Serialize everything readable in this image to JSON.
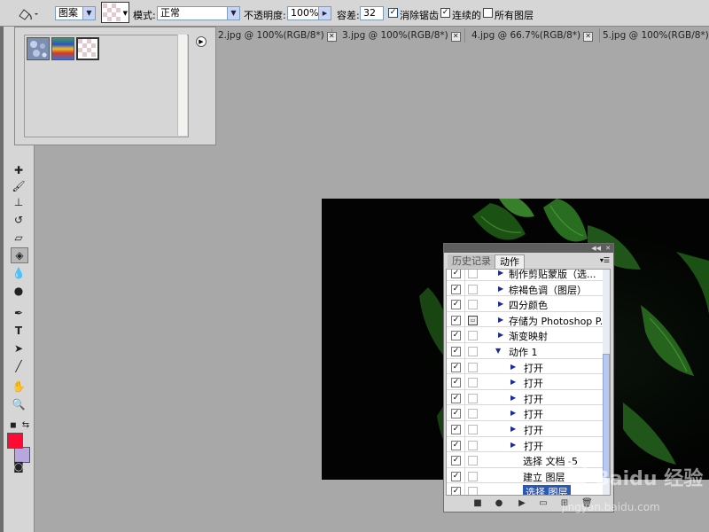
{
  "options_bar": {
    "fill_source": "图案",
    "mode_label": "模式:",
    "mode_value": "正常",
    "opacity_label": "不透明度:",
    "opacity_value": "100%",
    "tolerance_label": "容差:",
    "tolerance_value": "32",
    "antialias_label": "消除锯齿",
    "antialias_checked": true,
    "contiguous_label": "连续的",
    "contiguous_checked": true,
    "all_layers_label": "所有图层",
    "all_layers_checked": false
  },
  "doc_tabs": [
    {
      "label": "2.jpg @ 100%(RGB/8*)"
    },
    {
      "label": "3.jpg @ 100%(RGB/8*)"
    },
    {
      "label": "4.jpg @ 66.7%(RGB/8*)"
    },
    {
      "label": "5.jpg @ 100%(RGB/8*)"
    }
  ],
  "pattern_picker": {
    "swatches": [
      "blue-bubbles-pattern",
      "rainbow-pattern",
      "transparent-checker-pattern"
    ]
  },
  "colors": {
    "foreground": "#ff0a32",
    "background": "#b9a6de",
    "selection": "#2a5ab8"
  },
  "panel": {
    "tabs": [
      {
        "label": "历史记录",
        "active": false
      },
      {
        "label": "动作",
        "active": true
      }
    ],
    "rows": [
      {
        "text": "制作剪贴蒙版（选...",
        "checked": true,
        "dialog": false,
        "level": 1,
        "expanded": false
      },
      {
        "text": "棕褐色调（图层）",
        "checked": true,
        "dialog": false,
        "level": 1,
        "expanded": false
      },
      {
        "text": "四分颜色",
        "checked": true,
        "dialog": false,
        "level": 1,
        "expanded": false
      },
      {
        "text": "存储为 Photoshop P...",
        "checked": true,
        "dialog": true,
        "level": 1,
        "expanded": false
      },
      {
        "text": "渐变映射",
        "checked": true,
        "dialog": false,
        "level": 1,
        "expanded": false
      },
      {
        "text": "动作 1",
        "checked": true,
        "dialog": false,
        "level": 1,
        "expanded": true
      },
      {
        "text": "打开",
        "checked": true,
        "dialog": false,
        "level": 2,
        "expanded": false
      },
      {
        "text": "打开",
        "checked": true,
        "dialog": false,
        "level": 2,
        "expanded": false
      },
      {
        "text": "打开",
        "checked": true,
        "dialog": false,
        "level": 2,
        "expanded": false
      },
      {
        "text": "打开",
        "checked": true,
        "dialog": false,
        "level": 2,
        "expanded": false
      },
      {
        "text": "打开",
        "checked": true,
        "dialog": false,
        "level": 2,
        "expanded": false
      },
      {
        "text": "打开",
        "checked": true,
        "dialog": false,
        "level": 2,
        "expanded": false
      },
      {
        "text": "选择 文档 -5",
        "checked": true,
        "dialog": false,
        "level": 3,
        "expanded": false
      },
      {
        "text": "建立 图层",
        "checked": true,
        "dialog": false,
        "level": 3,
        "expanded": false
      },
      {
        "text": "选择 图层",
        "checked": true,
        "dialog": false,
        "level": 3,
        "expanded": false,
        "selected": true
      }
    ],
    "bottom_icons": [
      "stop-icon",
      "record-icon",
      "play-icon",
      "new-set-icon",
      "new-action-icon",
      "delete-icon"
    ]
  },
  "watermark": {
    "brand": "Baidu 经验",
    "url": "jingyan.baidu.com"
  }
}
